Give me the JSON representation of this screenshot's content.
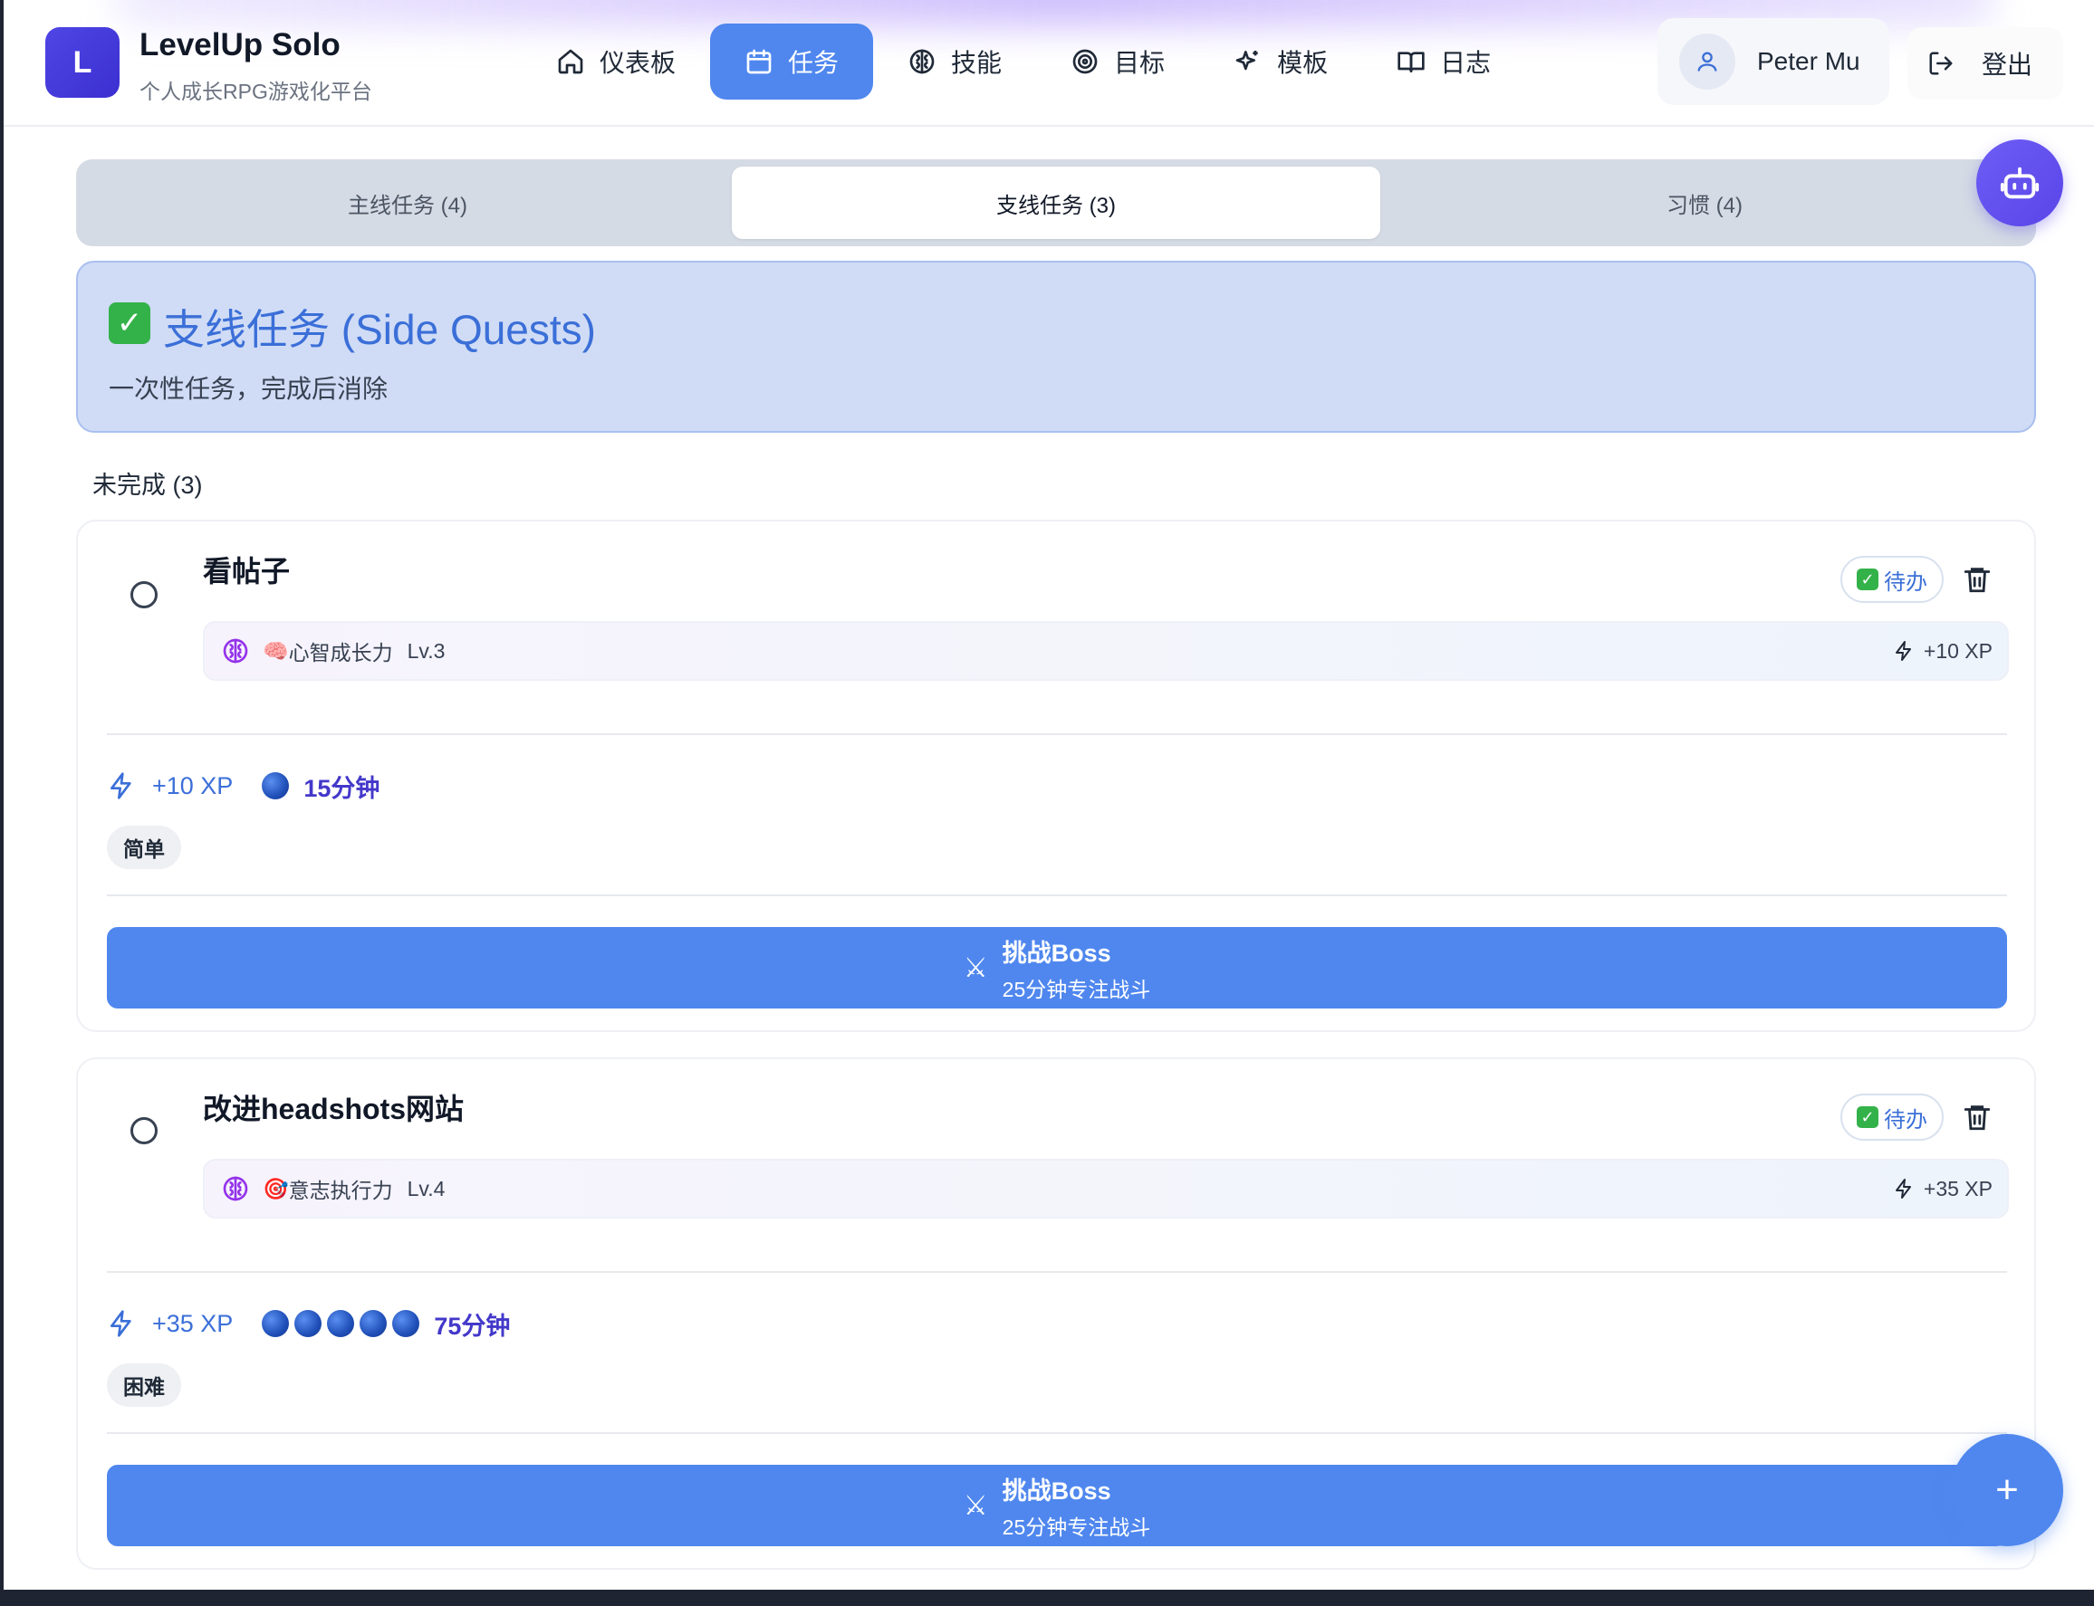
{
  "app": {
    "logo_letter": "L",
    "name": "LevelUp Solo",
    "subtitle": "个人成长RPG游戏化平台"
  },
  "nav": [
    {
      "label": "仪表板",
      "icon": "home-icon",
      "active": false
    },
    {
      "label": "任务",
      "icon": "calendar-icon",
      "active": true
    },
    {
      "label": "技能",
      "icon": "brain-icon",
      "active": false
    },
    {
      "label": "目标",
      "icon": "target-icon",
      "active": false
    },
    {
      "label": "模板",
      "icon": "sparkles-icon",
      "active": false
    },
    {
      "label": "日志",
      "icon": "book-icon",
      "active": false
    }
  ],
  "user": {
    "name": "Peter Mu",
    "logout": "登出"
  },
  "tabs": [
    {
      "label": "主线任务 (4)",
      "active": false
    },
    {
      "label": "支线任务 (3)",
      "active": true
    },
    {
      "label": "习惯 (4)",
      "active": false
    }
  ],
  "section": {
    "emoji": "✓",
    "title": "支线任务 (Side Quests)",
    "description": "一次性任务，完成后消除",
    "incomplete_label": "未完成 (3)"
  },
  "quests": [
    {
      "title": "看帖子",
      "status": "待办",
      "status_mark": "✓",
      "skill_emoji": "🧠",
      "skill_name": "心智成长力",
      "skill_level": "Lv.3",
      "skill_xp": "+10 XP",
      "xp": "+10 XP",
      "dots": 1,
      "time": "15分钟",
      "difficulty": "简单",
      "boss_label": "挑战Boss",
      "boss_sub": "25分钟专注战斗",
      "boss_icon": "⚔"
    },
    {
      "title": "改进headshots网站",
      "status": "待办",
      "status_mark": "✓",
      "skill_emoji": "🎯",
      "skill_name": "意志执行力",
      "skill_level": "Lv.4",
      "skill_xp": "+35 XP",
      "xp": "+35 XP",
      "dots": 5,
      "time": "75分钟",
      "difficulty": "困难",
      "boss_label": "挑战Boss",
      "boss_sub": "25分钟专注战斗",
      "boss_icon": "⚔"
    }
  ],
  "fab": {
    "label": "+"
  },
  "colors": {
    "accent": "#4f87ee",
    "brand": "#4f46e5",
    "banner_bg": "#d0dcf6",
    "title_blue": "#3b6fd8",
    "time_purple": "#4338ca"
  }
}
